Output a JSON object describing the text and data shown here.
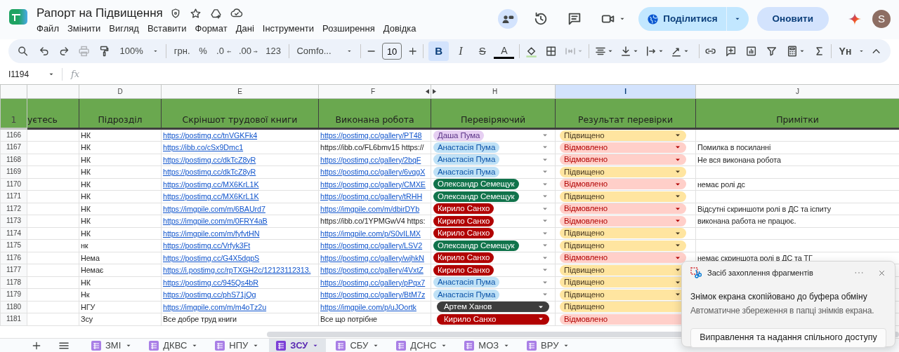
{
  "title": "Рапорт на Підвищення",
  "menu": [
    "Файл",
    "Змінити",
    "Вигляд",
    "Вставити",
    "Формат",
    "Дані",
    "Інструменти",
    "Розширення",
    "Довідка"
  ],
  "share_button": "Поділитися",
  "update_button": "Оновити",
  "avatar": "S",
  "toolbar": {
    "zoom": "100%",
    "currency": "грн.",
    "percent": "%",
    "decimals_decrease": ".0",
    "decimals_increase": ".00",
    "number_format": "123",
    "font": "Comfo...",
    "font_size": "10",
    "format_buttons": [
      {
        "label": "B",
        "kind": "bold",
        "selected": true
      },
      {
        "label": "I",
        "kind": "italic",
        "selected": false
      },
      {
        "label": "S",
        "kind": "strike",
        "selected": false
      },
      {
        "label": "A",
        "kind": "color",
        "selected": false
      }
    ],
    "case_button": "Yн"
  },
  "name_box": "I1194",
  "formula_label": "fx",
  "header_row_number": "1",
  "columns": [
    {
      "header": "уєтесь",
      "selected": false
    },
    {
      "letter": "D",
      "header": "Підрозділ",
      "selected": false
    },
    {
      "letter": "E",
      "header": "Скріншот трудової книги",
      "selected": false
    },
    {
      "letter": "F",
      "header": "Виконана робота",
      "selected": false,
      "hidden_after": true
    },
    {
      "letter": "H",
      "header": "Перевіряючий",
      "selected": false
    },
    {
      "letter": "I",
      "header": "Результат перевірки",
      "selected": true
    },
    {
      "letter": "J",
      "header": "Примітки",
      "selected": false
    }
  ],
  "rows": [
    {
      "number": "1166",
      "unit": "НК",
      "book": {
        "text": "https://postimg.cc/tnVGKFk4",
        "link": true
      },
      "work": {
        "text": "https://postimg.cc/gallery/PT48",
        "link": true
      },
      "checker": {
        "name": "Даша Пума",
        "color": "#e6cff2",
        "kind": "chip"
      },
      "result": {
        "text": "Підвищено",
        "color": "#ffe5a0",
        "dropdown": true
      }
    },
    {
      "number": "1167",
      "unit": "НК",
      "book": {
        "text": "https://ibb.co/cSx9Dmc1",
        "link": true
      },
      "work": {
        "text": "https://ibb.co/FL6bmv15 https://",
        "link": false
      },
      "checker": {
        "name": "Анастасія Пума",
        "color": "#bfe1f6",
        "kind": "chip"
      },
      "result": {
        "text": "Відмовлено",
        "color": "#ffcfc9",
        "dropdown": true
      },
      "note": "Помилка в посиланні"
    },
    {
      "number": "1168",
      "unit": "НК",
      "book": {
        "text": "https://postimg.cc/dkTcZ8yR",
        "link": true
      },
      "work": {
        "text": "https://postimg.cc/gallery/2bqF",
        "link": true
      },
      "checker": {
        "name": "Анастасія Пума",
        "color": "#bfe1f6",
        "kind": "chip"
      },
      "result": {
        "text": "Відмовлено",
        "color": "#ffcfc9",
        "dropdown": true
      },
      "note": "Не вся виконана робота"
    },
    {
      "number": "1169",
      "unit": "НК",
      "book": {
        "text": "https://postimg.cc/dkTcZ8yR",
        "link": true
      },
      "work": {
        "text": "https://postimg.cc/gallery/6vqgX",
        "link": true
      },
      "checker": {
        "name": "Анастасія Пума",
        "color": "#bfe1f6",
        "kind": "chip"
      },
      "result": {
        "text": "Підвищено",
        "color": "#ffe5a0",
        "dropdown": true
      }
    },
    {
      "number": "1170",
      "unit": "НК",
      "book": {
        "text": "https://postimg.cc/MX6KrL1K",
        "link": true
      },
      "work": {
        "text": "https://postimg.cc/gallery/CMXE",
        "link": true
      },
      "checker": {
        "name": "Олександр Семещук",
        "color": "#11734b",
        "kind": "chip"
      },
      "result": {
        "text": "Відмовлено",
        "color": "#ffcfc9",
        "dropdown": true
      },
      "note": "немає ролі дс"
    },
    {
      "number": "1171",
      "unit": "НК",
      "book": {
        "text": "https://postimg.cc/MX6KrL1K",
        "link": true
      },
      "work": {
        "text": "https://postimg.cc/gallery/tRHH",
        "link": true
      },
      "checker": {
        "name": "Олександр Семещук",
        "color": "#11734b",
        "kind": "chip"
      },
      "result": {
        "text": "Підвищено",
        "color": "#ffe5a0",
        "dropdown": true
      }
    },
    {
      "number": "1172",
      "unit": "НК",
      "book": {
        "text": "https://imgpile.com/m/6BAUrd7",
        "link": true
      },
      "work": {
        "text": "https://imgpile.com/m/dbirDYb",
        "link": true
      },
      "checker": {
        "name": "Кирило Санхо",
        "color": "#b10202",
        "kind": "chip"
      },
      "result": {
        "text": "Відмовлено",
        "color": "#ffcfc9",
        "dropdown": true
      },
      "note": "Відсутні скриншоти ролі в ДС та іспиту"
    },
    {
      "number": "1173",
      "unit": "НК",
      "book": {
        "text": "https://imgpile.com/m/0FRY4aB",
        "link": true
      },
      "work": {
        "text": "https://ibb.co/1YPMGwV4 https:",
        "link": false
      },
      "checker": {
        "name": "Кирило Санхо",
        "color": "#b10202",
        "kind": "chip"
      },
      "result": {
        "text": "Відмовлено",
        "color": "#ffcfc9",
        "dropdown": true
      },
      "note": "виконана работа не працює."
    },
    {
      "number": "1174",
      "unit": "НК",
      "book": {
        "text": "https://imgpile.com/m/fyfvtHN",
        "link": true
      },
      "work": {
        "text": "https://imgpile.com/p/S0vILMX",
        "link": true
      },
      "checker": {
        "name": "Кирило Санхо",
        "color": "#b10202",
        "kind": "chip"
      },
      "result": {
        "text": "Підвищено",
        "color": "#ffe5a0",
        "dropdown": true
      }
    },
    {
      "number": "1175",
      "unit": "нк",
      "book": {
        "text": "https://postimg.cc/Vrfyk3Ft",
        "link": true
      },
      "work": {
        "text": "https://postimg.cc/gallery/LSV2",
        "link": true
      },
      "checker": {
        "name": "Олександр Семещук",
        "color": "#11734b",
        "kind": "chip"
      },
      "result": {
        "text": "Підвищено",
        "color": "#ffe5a0",
        "dropdown": true
      }
    },
    {
      "number": "1176",
      "unit": "Нема",
      "book": {
        "text": "https://postimg.cc/G4X5dqpS",
        "link": true
      },
      "work": {
        "text": "https://postimg.cc/gallery/wjhkN",
        "link": true
      },
      "checker": {
        "name": "Кирило Санхо",
        "color": "#b10202",
        "kind": "chip"
      },
      "result": {
        "text": "Відмовлено",
        "color": "#ffcfc9",
        "dropdown": true
      },
      "note": "немає скриншота ролі в ДС та ТГ"
    },
    {
      "number": "1177",
      "unit": "Немає",
      "book": {
        "text": "https://i.postimg.cc/rpTXGH2c/12123112313.",
        "link": true
      },
      "work": {
        "text": "https://postimg.cc/gallery/4VxtZ",
        "link": true
      },
      "checker": {
        "name": "Кирило Санхо",
        "color": "#b10202",
        "kind": "chip"
      },
      "result": {
        "text": "Підвищено",
        "color": "#ffe5a0",
        "dropdown": true
      }
    },
    {
      "number": "1178",
      "unit": "НК",
      "book": {
        "text": "https://postimg.cc/945Qs4bR",
        "link": true
      },
      "work": {
        "text": "https://postimg.cc/gallery/pPqx7",
        "link": true
      },
      "checker": {
        "name": "Анастасія Пума",
        "color": "#bfe1f6",
        "kind": "chip"
      },
      "result": {
        "text": "Підвищено",
        "color": "#ffe5a0",
        "dropdown": true
      }
    },
    {
      "number": "1179",
      "unit": "Нк",
      "book": {
        "text": "https://postimg.cc/phS71jQg",
        "link": true
      },
      "work": {
        "text": "https://postimg.cc/gallery/BtM7z",
        "link": true
      },
      "checker": {
        "name": "Анастасія Пума",
        "color": "#bfe1f6",
        "kind": "chip"
      },
      "result": {
        "text": "Підвищено",
        "color": "#ffe5a0",
        "dropdown": true
      }
    },
    {
      "number": "1180",
      "unit": "НГУ",
      "book": {
        "text": "https://imgpile.com/m/m4oTz2u",
        "link": true
      },
      "work": {
        "text": "https://imgpile.com/p/uJOortk",
        "link": true
      },
      "checker": {
        "name": "Артем Ханов",
        "color": "#3d3d3d",
        "kind": "wide"
      },
      "result": {
        "text": "Підвищено",
        "color": "#ffe5a0",
        "dropdown": false
      }
    },
    {
      "number": "1181",
      "unit": "Зсу",
      "book": {
        "text": "Все добре труд книги",
        "link": false
      },
      "work": {
        "text": "Все що потрібне",
        "link": false
      },
      "checker": {
        "name": "Кирило Санхо",
        "color": "#b10202",
        "kind": "wide"
      },
      "result": {
        "text": "Відмовлено",
        "color": "#ffcfc9",
        "dropdown": false
      }
    }
  ],
  "sheet_tabs": [
    {
      "label": "ЗМІ",
      "selected": false
    },
    {
      "label": "ДКВС",
      "selected": false
    },
    {
      "label": "НПУ",
      "selected": false
    },
    {
      "label": "ЗСУ",
      "selected": true
    },
    {
      "label": "СБУ",
      "selected": false
    },
    {
      "label": "ДСНС",
      "selected": false
    },
    {
      "label": "МОЗ",
      "selected": false
    },
    {
      "label": "ВРУ",
      "selected": false
    }
  ],
  "notification": {
    "app": "Засіб захоплення фрагментів",
    "message": "Знімок екрана скопійовано до буфера обміну",
    "detail": "Автоматичне збереження в папці знімків екрана.",
    "button": "Виправлення та надання спільного доступу"
  }
}
